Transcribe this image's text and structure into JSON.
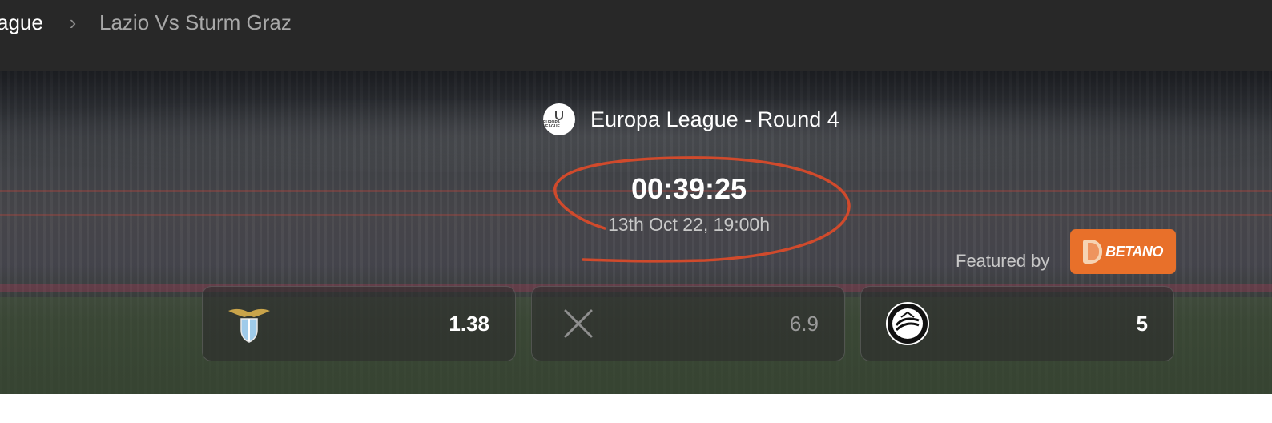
{
  "breadcrumb": {
    "previous": "ague",
    "separator": "›",
    "current": "Lazio Vs Sturm Graz"
  },
  "match": {
    "competition": "Europa League - Round 4",
    "competition_logo_text": "EUROPA LEAGUE",
    "countdown": "00:39:25",
    "datetime": "13th Oct 22, 19:00h"
  },
  "sponsor": {
    "featured_label": "Featured by",
    "brand": "BETANO",
    "brand_color": "#e8702a"
  },
  "odds": [
    {
      "team": "Lazio",
      "icon": "lazio-crest-icon",
      "value": "1.38"
    },
    {
      "team": "Draw",
      "icon": "close-icon",
      "value": "6.9"
    },
    {
      "team": "Sturm Graz",
      "icon": "sturm-graz-crest-icon",
      "value": "5"
    }
  ],
  "annotation_color": "#d04a2c"
}
